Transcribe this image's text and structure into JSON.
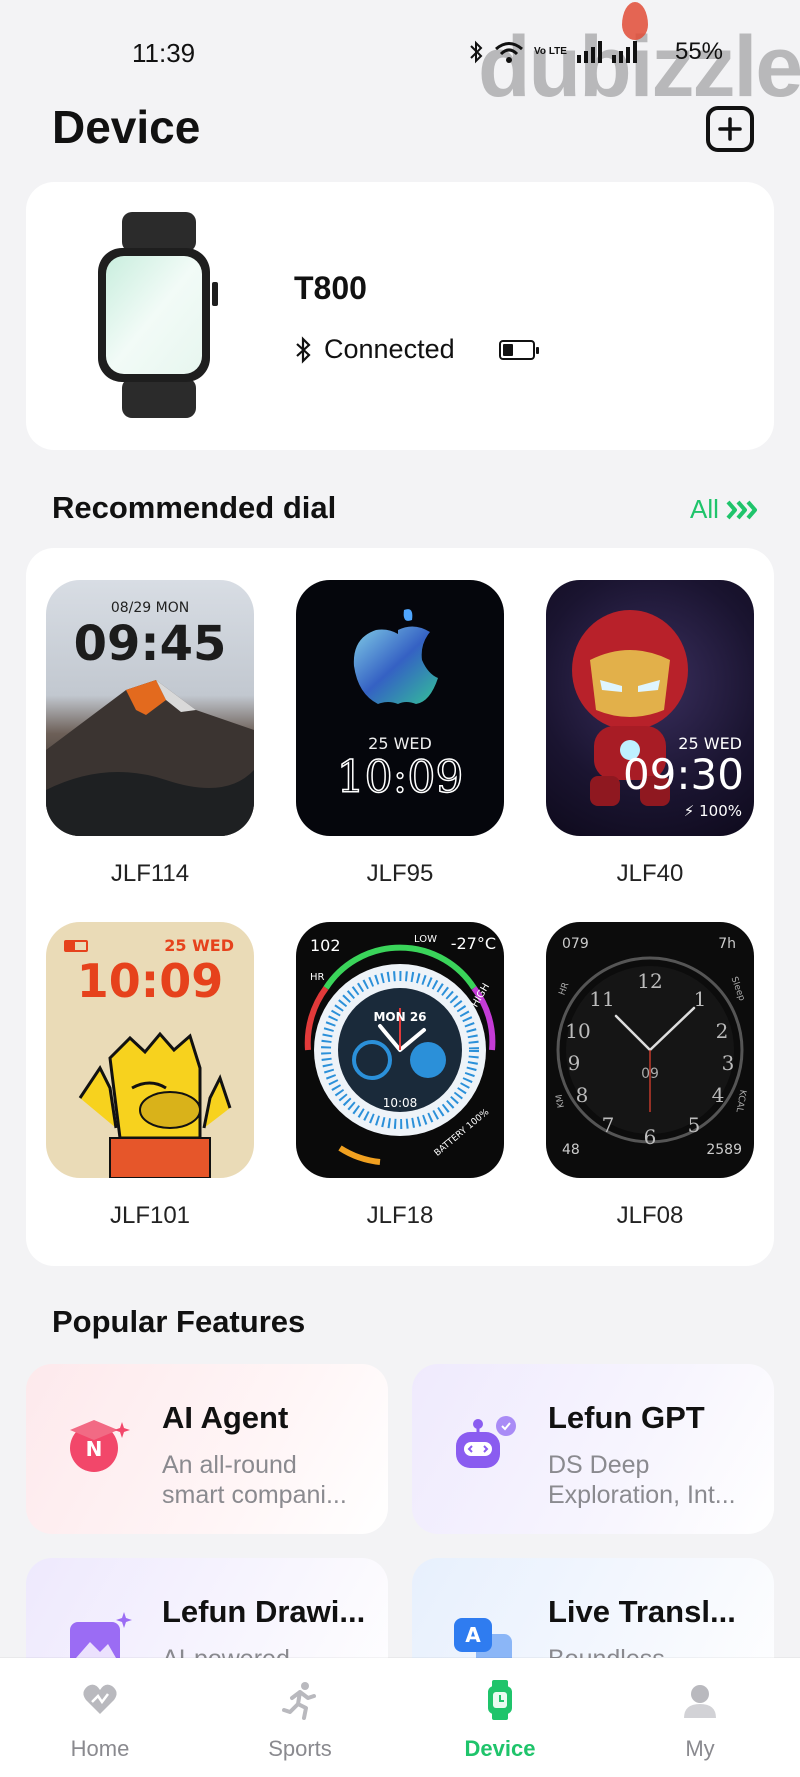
{
  "status_bar": {
    "time": "11:39",
    "battery": "55%",
    "volte": "Vo LTE"
  },
  "watermark": "dubizzle",
  "header": {
    "title": "Device"
  },
  "device": {
    "name": "T800",
    "status": "Connected",
    "battery_level": 0.35
  },
  "recommended": {
    "title": "Recommended dial",
    "all_label": "All",
    "dials": [
      {
        "name": "JLF114",
        "date": "08/29 MON",
        "time": "09:45"
      },
      {
        "name": "JLF95",
        "date": "25 WED",
        "time": "10:09"
      },
      {
        "name": "JLF40",
        "date": "25 WED",
        "time": "09:30",
        "battery": "100%"
      },
      {
        "name": "JLF101",
        "date": "25 WED",
        "time": "10:09"
      },
      {
        "name": "JLF18",
        "date": "MON 26",
        "time": "10:08",
        "top_left": "102",
        "low": "LOW",
        "temp": "-27°C",
        "high": "HIGH",
        "hr": "HR",
        "battery": "BATTERY 100%"
      },
      {
        "name": "JLF08",
        "top_left": "079",
        "top_right": "7h",
        "bottom_left": "48",
        "bottom_right": "2589",
        "center": "09",
        "hr": "HR",
        "sleep": "Sleep",
        "km": "KM",
        "kcal": "KCAL"
      }
    ]
  },
  "features": {
    "title": "Popular Features",
    "items": [
      {
        "title": "AI Agent",
        "desc": "An all-round\nsmart compani..."
      },
      {
        "title": "Lefun GPT",
        "desc": "DS Deep\nExploration, Int..."
      },
      {
        "title": "Lefun Drawi...",
        "desc": "AI-powered"
      },
      {
        "title": "Live Transl...",
        "desc": "Boundless"
      }
    ]
  },
  "nav": {
    "items": [
      {
        "label": "Home",
        "icon": "heart-icon"
      },
      {
        "label": "Sports",
        "icon": "runner-icon"
      },
      {
        "label": "Device",
        "icon": "watch-icon"
      },
      {
        "label": "My",
        "icon": "person-icon"
      }
    ],
    "active": "Device"
  },
  "colors": {
    "accent": "#1fc46b",
    "background": "#f3f3f5",
    "card": "#ffffff"
  }
}
